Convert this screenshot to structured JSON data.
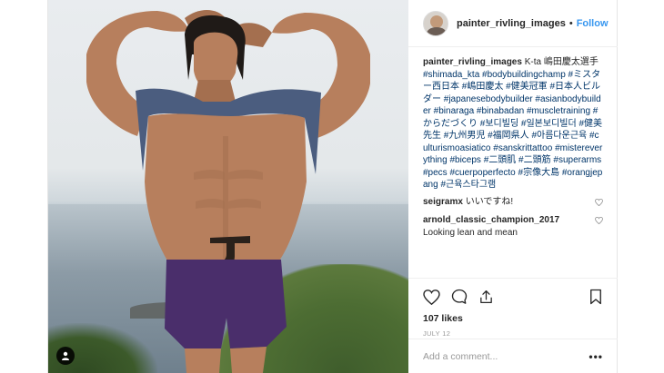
{
  "header": {
    "username": "painter_rivling_images",
    "separator": "•",
    "follow_label": "Follow"
  },
  "caption": {
    "username": "painter_rivling_images",
    "text": "K-ta 嶋田慶太選手",
    "hashtags": "#shimada_kta #bodybuildingchamp #ミスター西日本 #嶋田慶太 #健美冠軍 #日本人ビルダー #japanesebodybuilder #asianbodybuilder #binaraga #binabadan #muscletraining #からだづくり #보디빌딩 #일본보디빌더 #健美先生 #九州男児 #福岡県人 #아름다운근육 #culturismoasiatico #sanskrittattoo #mistereverything #biceps #二頭肌 #二頭筋 #superarms #pecs #cuerpoperfecto #宗像大島 #orangjepang #근육스타그램"
  },
  "comments": [
    {
      "username": "seigramx",
      "text": "いいですね!"
    },
    {
      "username": "arnold_classic_champion_2017",
      "text": "Looking lean and mean"
    }
  ],
  "actions": {
    "likes": "107 likes",
    "date": "JULY 12"
  },
  "add_comment": {
    "placeholder": "Add a comment...",
    "more_label": "•••"
  },
  "icons": [
    "user-tag-icon",
    "heart-icon",
    "comment-icon",
    "share-icon",
    "bookmark-icon",
    "more-options-icon"
  ]
}
